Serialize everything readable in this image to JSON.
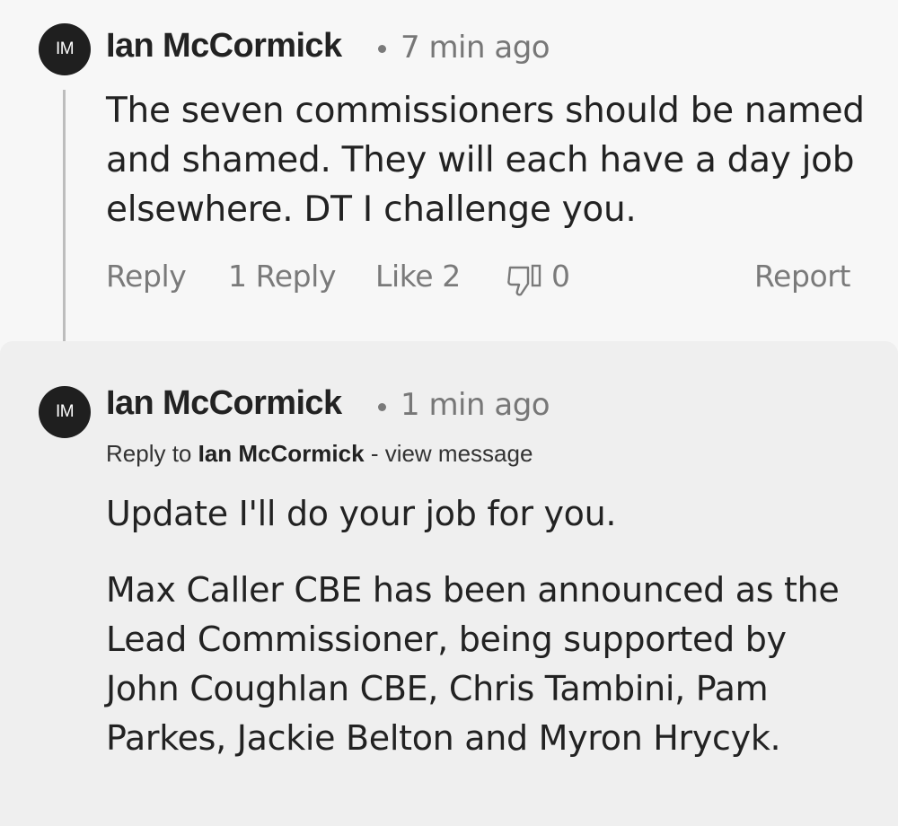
{
  "comment": {
    "avatar_initials": "IM",
    "author": "Ian McCormick",
    "time": "7 min ago",
    "body": "The seven commissioners should be named and shamed. They will each have a day job elsewhere. DT I challenge you.",
    "actions": {
      "reply": "Reply",
      "replies_count": "1 Reply",
      "like": "Like 2",
      "dislike_count": "0",
      "report": "Report"
    }
  },
  "reply": {
    "avatar_initials": "IM",
    "author": "Ian McCormick",
    "time": "1 min ago",
    "reply_to_prefix": "Reply to",
    "reply_to_author": "Ian McCormick",
    "view_message": "- view message",
    "para1": "Update I'll do your job for you.",
    "para2": "Max Caller CBE has been announced as the Lead Commissioner, being supported by John Coughlan CBE, Chris Tambini, Pam Parkes, Jackie Belton and Myron Hrycyk."
  },
  "colors": {
    "background": "#f7f7f7",
    "reply_background": "#efefef",
    "avatar": "#1f1f1f",
    "muted_text": "#777777"
  },
  "icons": {
    "dislike": "thumbs-down-icon"
  }
}
